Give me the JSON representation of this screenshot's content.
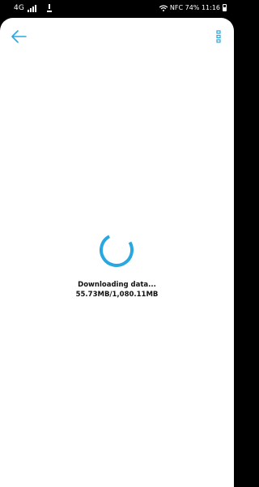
{
  "status_bar": {
    "network": "4G",
    "right_text": "NFC 74% 11:16"
  },
  "page": {
    "back_icon": "arrow-left-icon",
    "more_icon": "more-vertical-icon",
    "accent_color": "#29a8e0"
  },
  "loading": {
    "message": "Downloading data...",
    "progress": "55.73MB/1,080.11MB"
  }
}
